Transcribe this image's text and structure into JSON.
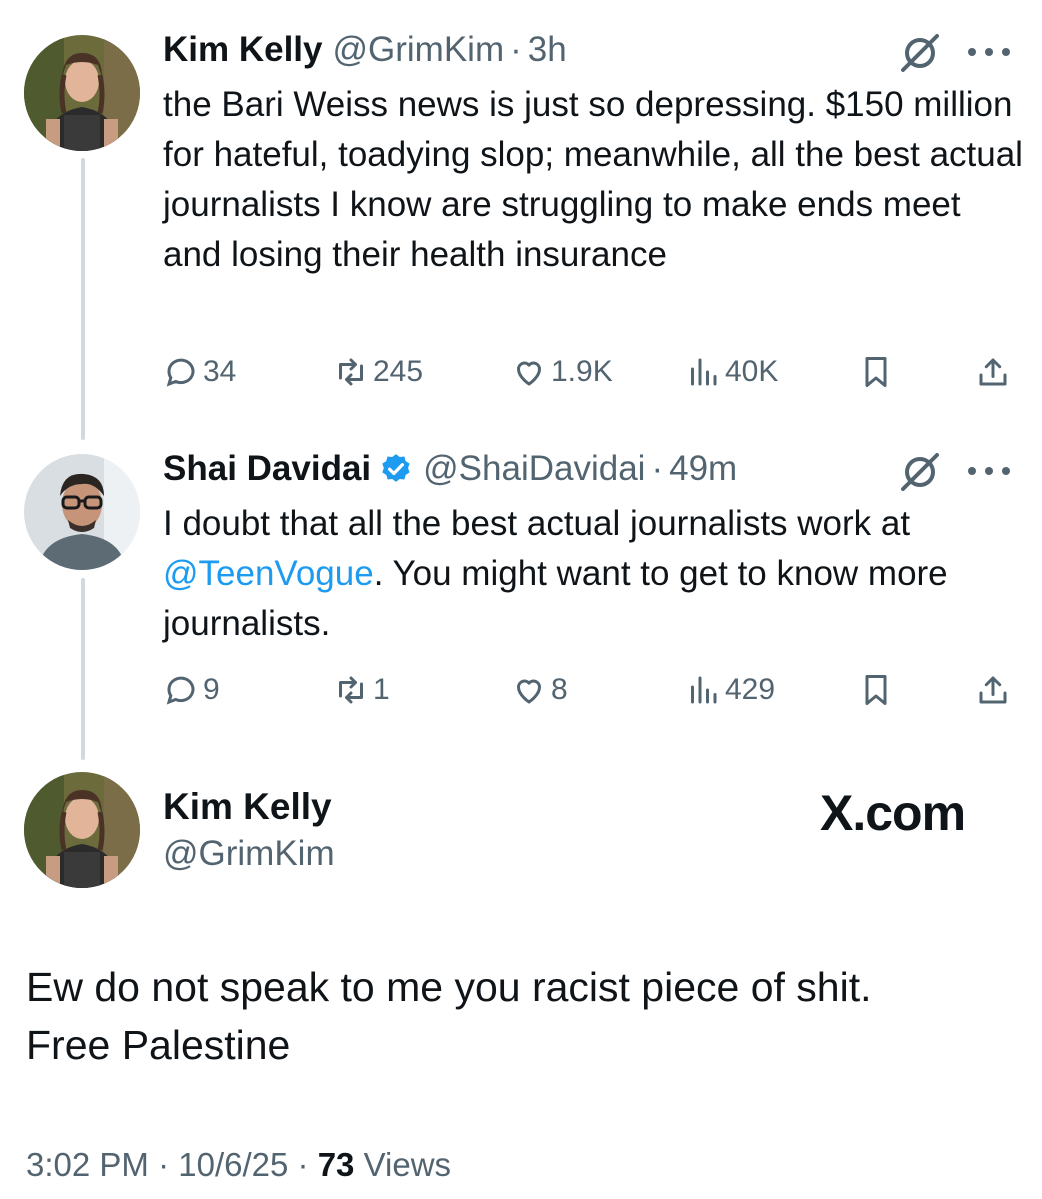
{
  "tweets": [
    {
      "name": "Kim Kelly",
      "handle": "@GrimKim",
      "time": "3h",
      "text": "the Bari Weiss news is just so depressing. $150 million for hateful, toadying slop; meanwhile, all the best actual journalists I know are struggling to make ends meet and losing their health insurance",
      "replies": "34",
      "reposts": "245",
      "likes": "1.9K",
      "views": "40K"
    },
    {
      "name": "Shai Davidai",
      "handle": "@ShaiDavidai",
      "time": "49m",
      "verified": true,
      "text_before": "I doubt that all the best actual journalists work at ",
      "mention": "@TeenVogue",
      "text_after": ". You might want to get to know more journalists.",
      "replies": "9",
      "reposts": "1",
      "likes": "8",
      "views": "429"
    }
  ],
  "main": {
    "name": "Kim Kelly",
    "handle": "@GrimKim",
    "watermark": "X.com",
    "text_line1": "Ew do not speak to me you racist piece of shit.",
    "text_line2": "Free Palestine",
    "time": "3:02 PM",
    "date": "10/6/25",
    "sep": "·",
    "views_count": "73",
    "views_label": "Views"
  },
  "colors": {
    "link": "#1d9bf0",
    "secondary": "#536471",
    "text": "#0f1419",
    "verified": "#1d9bf0"
  },
  "icons": [
    "reply-icon",
    "repost-icon",
    "like-icon",
    "views-icon",
    "bookmark-icon",
    "share-icon",
    "grok-icon",
    "more-icon",
    "verified-badge-icon"
  ]
}
